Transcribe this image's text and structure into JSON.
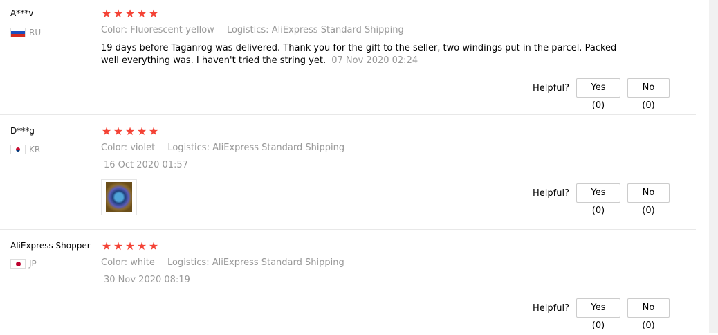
{
  "reviews": [
    {
      "user": "A***v",
      "country": "RU",
      "flag_icon": "russia-flag-icon",
      "rating": 5,
      "color_label": "Color:",
      "color_value": "Fluorescent-yellow",
      "logistics_label": "Logistics:",
      "logistics_value": "AliExpress Standard Shipping",
      "text": "19 days before Taganrog was delivered. Thank you for the gift to the seller, two windings put in the parcel. Packed well everything was. I haven't tried the string yet.",
      "date": "07 Nov 2020 02:24",
      "helpful_label": "Helpful?",
      "yes_label": "Yes (0)",
      "no_label": "No (0)"
    },
    {
      "user": "D***g",
      "country": "KR",
      "flag_icon": "south-korea-flag-icon",
      "rating": 5,
      "color_label": "Color:",
      "color_value": "violet",
      "logistics_label": "Logistics:",
      "logistics_value": "AliExpress Standard Shipping",
      "date": "16 Oct 2020 01:57",
      "has_photo": true,
      "helpful_label": "Helpful?",
      "yes_label": "Yes (0)",
      "no_label": "No (0)"
    },
    {
      "user": "AliExpress Shopper",
      "country": "JP",
      "flag_icon": "japan-flag-icon",
      "rating": 5,
      "color_label": "Color:",
      "color_value": "white",
      "logistics_label": "Logistics:",
      "logistics_value": "AliExpress Standard Shipping",
      "date": "30 Nov 2020 08:19",
      "helpful_label": "Helpful?",
      "yes_label": "Yes (0)",
      "no_label": "No (0)"
    }
  ],
  "colors": {
    "star": "#f44336",
    "muted_text": "#999999",
    "divider": "#e8e8e8",
    "scrollbar_track": "#f1f1f1"
  }
}
